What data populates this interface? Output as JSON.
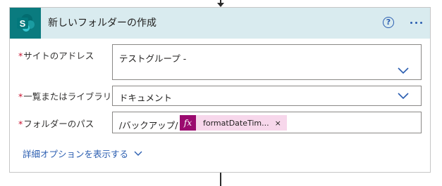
{
  "action": {
    "title": "新しいフォルダーの作成",
    "icon": "sharepoint-logo",
    "help_glyph": "?",
    "more_glyph": "..."
  },
  "fields": [
    {
      "label": "サイトのアドレス",
      "required": "*",
      "value": "テストグループ -"
    },
    {
      "label": "一覧またはライブラリ",
      "required": "*",
      "value": "ドキュメント"
    },
    {
      "label": "フォルダーのパス",
      "required": "*",
      "value": "/バックアップ/"
    }
  ],
  "token": {
    "fx_glyph": "fx",
    "label": "formatDateTim...",
    "close_glyph": "×"
  },
  "advanced_options": {
    "label": "詳細オプションを表示する"
  },
  "colors": {
    "header_bg": "#d9ebef",
    "app_icon_bg": "#0a7b7f",
    "accent_blue": "#2a5db0",
    "required_red": "#c8102e",
    "token_bg": "#f7d7eb",
    "token_fx_bg": "#9b0a6f"
  }
}
